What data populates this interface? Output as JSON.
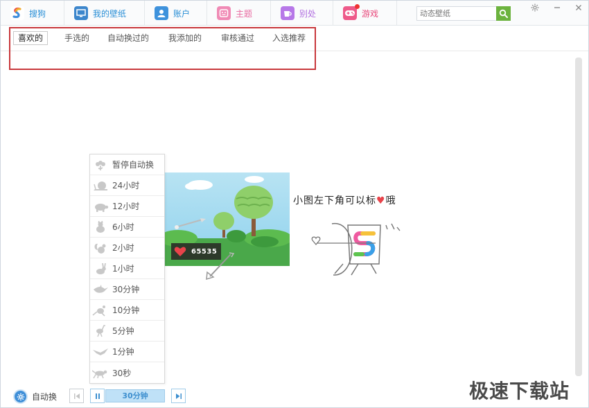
{
  "nav": {
    "tabs": [
      {
        "label": "搜狗",
        "icon": "sogou-logo-icon",
        "color": "#2a8fd6"
      },
      {
        "label": "我的壁纸",
        "icon": "monitor-icon",
        "color": "#2a8fd6"
      },
      {
        "label": "账户",
        "icon": "user-icon",
        "color": "#2a8fd6"
      },
      {
        "label": "主题",
        "icon": "theme-icon",
        "color": "#e86aa0"
      },
      {
        "label": "别处",
        "icon": "cup-icon",
        "color": "#b06de0"
      },
      {
        "label": "游戏",
        "icon": "gamepad-icon",
        "color": "#e8477a"
      }
    ],
    "search_placeholder": "动态壁纸"
  },
  "subtabs": [
    {
      "label": "喜欢的",
      "active": true
    },
    {
      "label": "手选的",
      "active": false
    },
    {
      "label": "自动换过的",
      "active": false
    },
    {
      "label": "我添加的",
      "active": false
    },
    {
      "label": "审核通过",
      "active": false
    },
    {
      "label": "入选推荐",
      "active": false
    }
  ],
  "interval_menu": {
    "items": [
      {
        "label": "暂停自动换",
        "icon": "flower-icon"
      },
      {
        "label": "24小时",
        "icon": "snail-icon"
      },
      {
        "label": "12小时",
        "icon": "tortoise-icon"
      },
      {
        "label": "6小时",
        "icon": "cat-icon"
      },
      {
        "label": "2小时",
        "icon": "squirrel-icon"
      },
      {
        "label": "1小时",
        "icon": "rabbit-icon"
      },
      {
        "label": "30分钟",
        "icon": "bird-icon"
      },
      {
        "label": "10分钟",
        "icon": "kangaroo-icon"
      },
      {
        "label": "5分钟",
        "icon": "ostrich-icon"
      },
      {
        "label": "1分钟",
        "icon": "eagle-icon"
      },
      {
        "label": "30秒",
        "icon": "cheetah-icon"
      }
    ]
  },
  "empty_state": {
    "likes": "65535",
    "hint": "小图左下角可以标",
    "hint_suffix": "哦"
  },
  "bottom": {
    "auto_label": "自动换",
    "timer_label": "30分钟"
  },
  "watermark": "极速下载站",
  "colors": {
    "accent_blue": "#3f8fd8",
    "highlight_red": "#c8363a",
    "search_green": "#6cb33e",
    "heart_red": "#e8434a"
  }
}
